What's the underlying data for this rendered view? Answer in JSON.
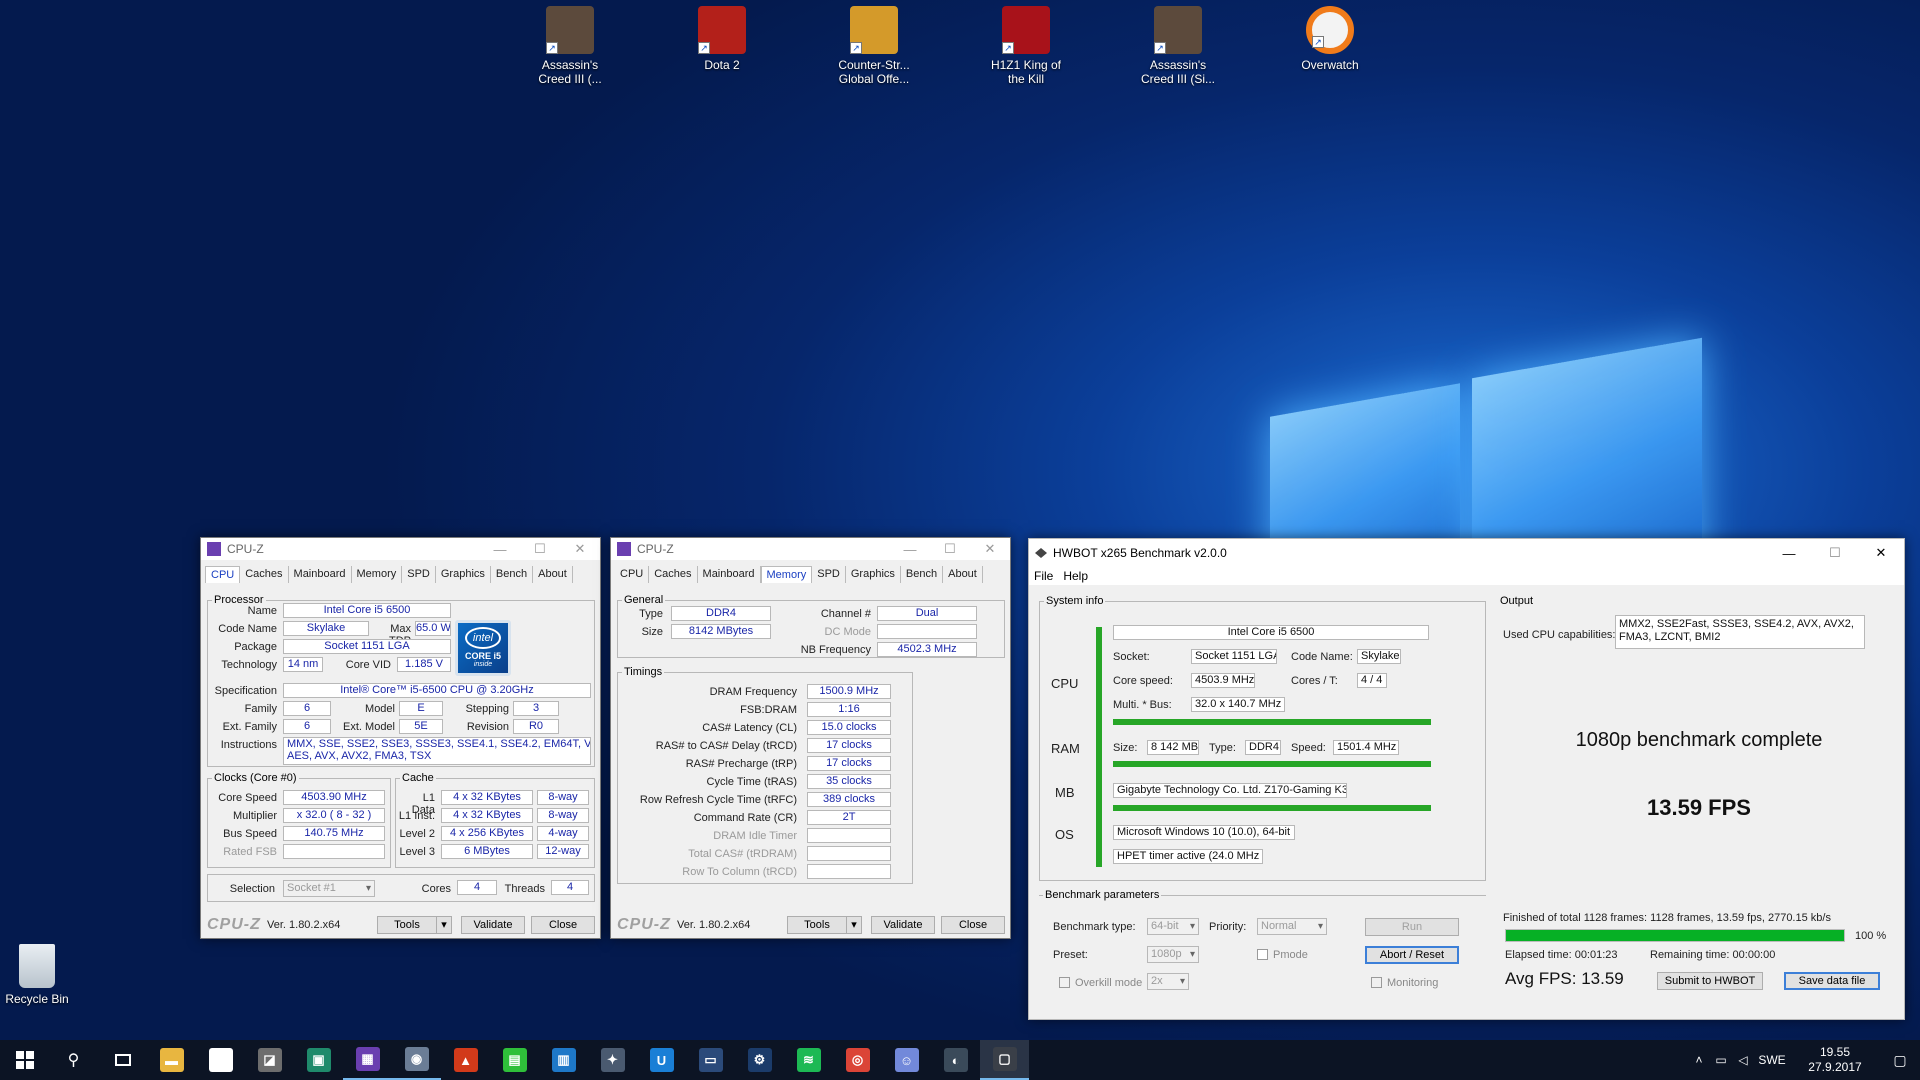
{
  "desktop": {
    "icons": [
      {
        "label": "Assassin's Creed III (...",
        "color": "#5c4a3c"
      },
      {
        "label": "Dota 2",
        "color": "#b3201a"
      },
      {
        "label": "Counter-Str... Global Offe...",
        "color": "#d49a2a"
      },
      {
        "label": "H1Z1 King of the Kill",
        "color": "#a8121a"
      },
      {
        "label": "Assassin's Creed III (Si...",
        "color": "#5c4a3c"
      },
      {
        "label": "Overwatch",
        "color": "#f3f3f3"
      }
    ],
    "recycle_bin": "Recycle Bin"
  },
  "cpuz1": {
    "title": "CPU-Z",
    "tabs": [
      "CPU",
      "Caches",
      "Mainboard",
      "Memory",
      "SPD",
      "Graphics",
      "Bench",
      "About"
    ],
    "active_tab": "CPU",
    "processor_legend": "Processor",
    "name_label": "Name",
    "name": "Intel Core i5 6500",
    "codename_label": "Code Name",
    "codename": "Skylake",
    "maxtdp_label": "Max TDP",
    "maxtdp": "65.0 W",
    "package_label": "Package",
    "package": "Socket 1151 LGA",
    "technology_label": "Technology",
    "technology": "14 nm",
    "corevid_label": "Core VID",
    "corevid": "1.185 V",
    "spec_label": "Specification",
    "spec": "Intel® Core™ i5-6500 CPU @ 3.20GHz",
    "family_label": "Family",
    "family": "6",
    "model_label": "Model",
    "model": "E",
    "stepping_label": "Stepping",
    "stepping": "3",
    "extfamily_label": "Ext. Family",
    "extfamily": "6",
    "extmodel_label": "Ext. Model",
    "extmodel": "5E",
    "revision_label": "Revision",
    "revision": "R0",
    "instructions_label": "Instructions",
    "instructions_1": "MMX, SSE, SSE2, SSE3, SSSE3, SSE4.1, SSE4.2, EM64T, VT-x,",
    "instructions_2": "AES, AVX, AVX2, FMA3, TSX",
    "clocks_legend": "Clocks (Core #0)",
    "corespeed_label": "Core Speed",
    "corespeed": "4503.90 MHz",
    "multiplier_label": "Multiplier",
    "multiplier": "x 32.0 ( 8 - 32 )",
    "busspeed_label": "Bus Speed",
    "busspeed": "140.75 MHz",
    "ratedfsb_label": "Rated FSB",
    "cache_legend": "Cache",
    "l1data_label": "L1 Data",
    "l1data": "4 x 32 KBytes",
    "l1data_way": "8-way",
    "l1inst_label": "L1 Inst.",
    "l1inst": "4 x 32 KBytes",
    "l1inst_way": "8-way",
    "l2_label": "Level 2",
    "l2": "4 x 256 KBytes",
    "l2_way": "4-way",
    "l3_label": "Level 3",
    "l3": "6 MBytes",
    "l3_way": "12-way",
    "selection_label": "Selection",
    "selection": "Socket #1",
    "cores_label": "Cores",
    "cores": "4",
    "threads_label": "Threads",
    "threads": "4",
    "logo": "CPU-Z",
    "version": "Ver. 1.80.2.x64",
    "tools": "Tools",
    "validate": "Validate",
    "close": "Close",
    "intel_ring": "intel",
    "intel_core": "CORE i5",
    "intel_inside": "inside"
  },
  "cpuz2": {
    "title": "CPU-Z",
    "tabs": [
      "CPU",
      "Caches",
      "Mainboard",
      "Memory",
      "SPD",
      "Graphics",
      "Bench",
      "About"
    ],
    "active_tab": "Memory",
    "general_legend": "General",
    "type_label": "Type",
    "type": "DDR4",
    "channel_label": "Channel #",
    "channel": "Dual",
    "size_label": "Size",
    "size": "8142 MBytes",
    "dcmode_label": "DC Mode",
    "nbfreq_label": "NB Frequency",
    "nbfreq": "4502.3 MHz",
    "timings_legend": "Timings",
    "dramfreq_label": "DRAM Frequency",
    "dramfreq": "1500.9 MHz",
    "fsbdram_label": "FSB:DRAM",
    "fsbdram": "1:16",
    "cl_label": "CAS# Latency (CL)",
    "cl": "15.0 clocks",
    "trcd_label": "RAS# to CAS# Delay (tRCD)",
    "trcd": "17 clocks",
    "trp_label": "RAS# Precharge (tRP)",
    "trp": "17 clocks",
    "tras_label": "Cycle Time (tRAS)",
    "tras": "35 clocks",
    "trfc_label": "Row Refresh Cycle Time (tRFC)",
    "trfc": "389 clocks",
    "cr_label": "Command Rate (CR)",
    "cr": "2T",
    "idle_label": "DRAM Idle Timer",
    "trdram_label": "Total CAS# (tRDRAM)",
    "trcd2_label": "Row To Column (tRCD)",
    "logo": "CPU-Z",
    "version": "Ver. 1.80.2.x64",
    "tools": "Tools",
    "validate": "Validate",
    "close": "Close"
  },
  "hwbot": {
    "title": "HWBOT x265 Benchmark v2.0.0",
    "menu_file": "File",
    "menu_help": "Help",
    "sysinfo_legend": "System info",
    "cpu_label": "CPU",
    "cpu_name": "Intel Core i5 6500",
    "socket_label": "Socket:",
    "socket": "Socket 1151 LGA",
    "codename_label": "Code Name:",
    "codename": "Skylake",
    "corespeed_label": "Core speed:",
    "corespeed": "4503.9 MHz",
    "corest_label": "Cores / T:",
    "corest": "4 / 4",
    "multibus_label": "Multi. * Bus:",
    "multibus": "32.0 x 140.7 MHz",
    "ram_label": "RAM",
    "ramsize_label": "Size:",
    "ramsize": "8 142 MB",
    "ramtype_label": "Type:",
    "ramtype": "DDR4",
    "ramspeed_label": "Speed:",
    "ramspeed": "1501.4 MHz",
    "mb_label": "MB",
    "mb": "Gigabyte Technology Co. Ltd. Z170-Gaming K3",
    "os_label": "OS",
    "os": "Microsoft Windows 10 (10.0), 64-bit",
    "hpet": "HPET timer active (24.0 MHz )",
    "params_legend": "Benchmark parameters",
    "benchtype_label": "Benchmark type:",
    "benchtype": "64-bit",
    "priority_label": "Priority:",
    "priority": "Normal",
    "run": "Run",
    "preset_label": "Preset:",
    "preset": "1080p",
    "pmode_label": "Pmode",
    "abort": "Abort / Reset",
    "overkill_label": "Overkill mode",
    "overkill": "2x",
    "monitoring_label": "Monitoring",
    "output_legend": "Output",
    "caps_label": "Used CPU capabilities:",
    "caps_1": "MMX2, SSE2Fast, SSSE3, SSE4.2, AVX, AVX2,",
    "caps_2": "FMA3, LZCNT, BMI2",
    "complete": "1080p benchmark complete",
    "fps": "13.59 FPS",
    "finished": "Finished of total 1128 frames: 1128 frames, 13.59 fps,  2770.15 kb/s",
    "progress_pct": 100,
    "progress_text": "100 %",
    "elapsed": "Elapsed time: 00:01:23",
    "remaining": "Remaining time: 00:00:00",
    "avgfps": "Avg FPS: 13.59",
    "submit": "Submit to HWBOT",
    "save": "Save data file"
  },
  "taskbar": {
    "lang": "SWE",
    "time": "19.55",
    "date": "27.9.2017",
    "apps": [
      {
        "icon": "file-explorer-icon",
        "color": "#e8b640",
        "glyph": "▬"
      },
      {
        "icon": "steam-icon",
        "color": "#ffffff",
        "glyph": "⚙"
      },
      {
        "icon": "gpu-tool-icon",
        "color": "#6d6d6d",
        "glyph": "◪"
      },
      {
        "icon": "monitor-app-icon",
        "color": "#1f8a6b",
        "glyph": "▣"
      },
      {
        "icon": "cpuz-icon",
        "color": "#6a3fb0",
        "glyph": "▦"
      },
      {
        "icon": "hwbot-icon",
        "color": "#6b7d96",
        "glyph": "◉"
      },
      {
        "icon": "burn-test-icon",
        "color": "#d23a1a",
        "glyph": "▲"
      },
      {
        "icon": "stats-app-icon",
        "color": "#2fbf3a",
        "glyph": "▤"
      },
      {
        "icon": "chart-app-icon",
        "color": "#1e78c8",
        "glyph": "▥"
      },
      {
        "icon": "game-app-icon",
        "color": "#4a5a70",
        "glyph": "✦"
      },
      {
        "icon": "uplay-icon",
        "color": "#1a7fd6",
        "glyph": "U"
      },
      {
        "icon": "media-app-icon",
        "color": "#2b4a7a",
        "glyph": "▭"
      },
      {
        "icon": "steam-client-icon",
        "color": "#1b3b6a",
        "glyph": "⚙"
      },
      {
        "icon": "spotify-icon",
        "color": "#1db954",
        "glyph": "≋"
      },
      {
        "icon": "chrome-icon",
        "color": "#db4437",
        "glyph": "◎"
      },
      {
        "icon": "discord-icon",
        "color": "#7289da",
        "glyph": "☺"
      },
      {
        "icon": "audio-app-icon",
        "color": "#3a4a5a",
        "glyph": "◐"
      },
      {
        "icon": "benchmark-app-icon",
        "color": "#3a3f48",
        "glyph": "▢"
      }
    ]
  }
}
